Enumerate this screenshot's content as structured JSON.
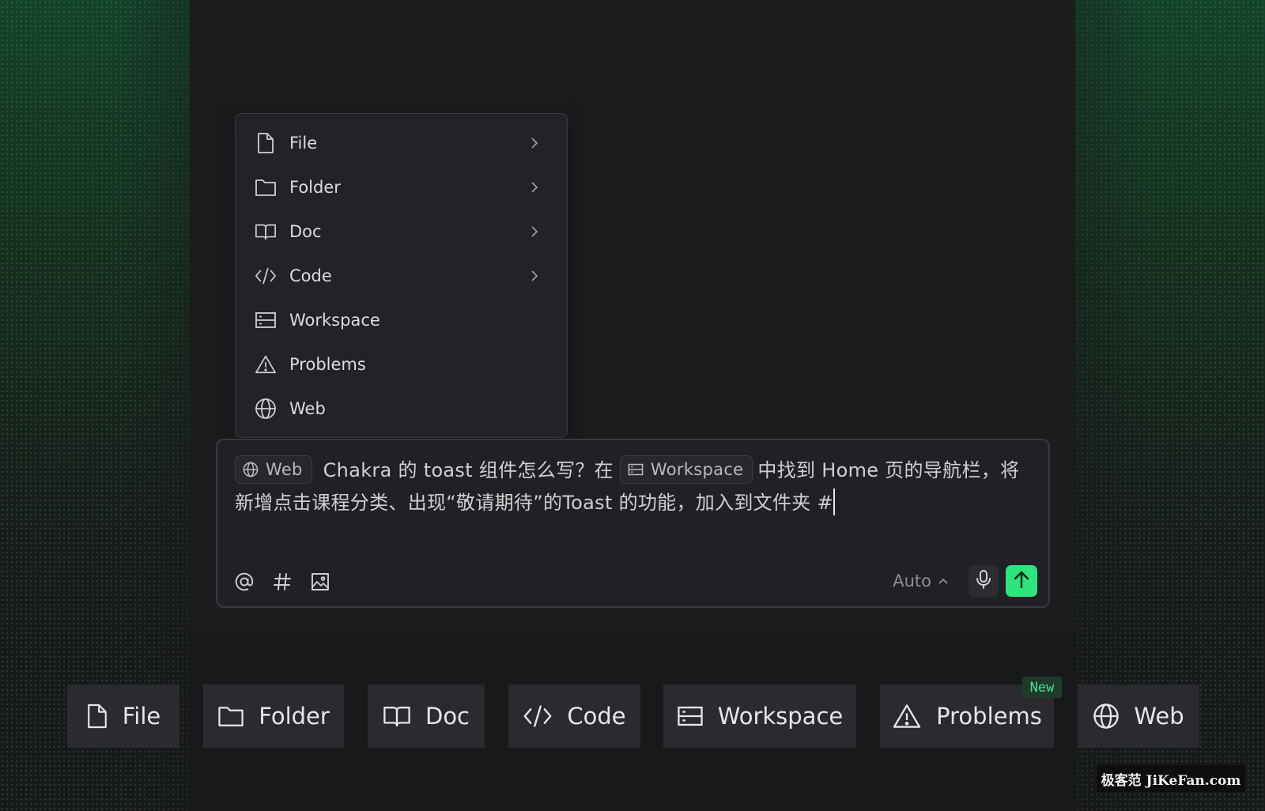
{
  "menu": {
    "items": [
      {
        "label": "File",
        "icon": "file-icon",
        "has_submenu": true
      },
      {
        "label": "Folder",
        "icon": "folder-icon",
        "has_submenu": true
      },
      {
        "label": "Doc",
        "icon": "book-icon",
        "has_submenu": true
      },
      {
        "label": "Code",
        "icon": "code-icon",
        "has_submenu": true
      },
      {
        "label": "Workspace",
        "icon": "workspace-icon",
        "has_submenu": false
      },
      {
        "label": "Problems",
        "icon": "warning-icon",
        "has_submenu": false
      },
      {
        "label": "Web",
        "icon": "globe-icon",
        "has_submenu": false
      }
    ]
  },
  "chat": {
    "chip_web": "Web",
    "text_1": "Chakra 的 toast 组件怎么写？在",
    "chip_workspace": "Workspace",
    "text_2": "中找到 Home 页的导航栏，将新增点击课程分类、出现“敬请期待”的Toast 的功能，加入到文件夹 #",
    "toolbar": {
      "mention_icon": "at-icon",
      "hash_icon": "hash-icon",
      "image_icon": "image-icon"
    },
    "model_label": "Auto",
    "mic_icon": "microphone-icon",
    "send_icon": "arrow-up-icon"
  },
  "bottom_chips": [
    {
      "label": "File",
      "icon": "file-icon"
    },
    {
      "label": "Folder",
      "icon": "folder-icon"
    },
    {
      "label": "Doc",
      "icon": "book-icon"
    },
    {
      "label": "Code",
      "icon": "code-icon"
    },
    {
      "label": "Workspace",
      "icon": "workspace-icon"
    },
    {
      "label": "Problems",
      "icon": "warning-icon",
      "badge": "New"
    },
    {
      "label": "Web",
      "icon": "globe-icon"
    }
  ],
  "watermark": "极客范 JiKeFan.com",
  "colors": {
    "accent_green": "#2ee57d",
    "badge_text": "#46e08a",
    "background": "#18191b"
  }
}
